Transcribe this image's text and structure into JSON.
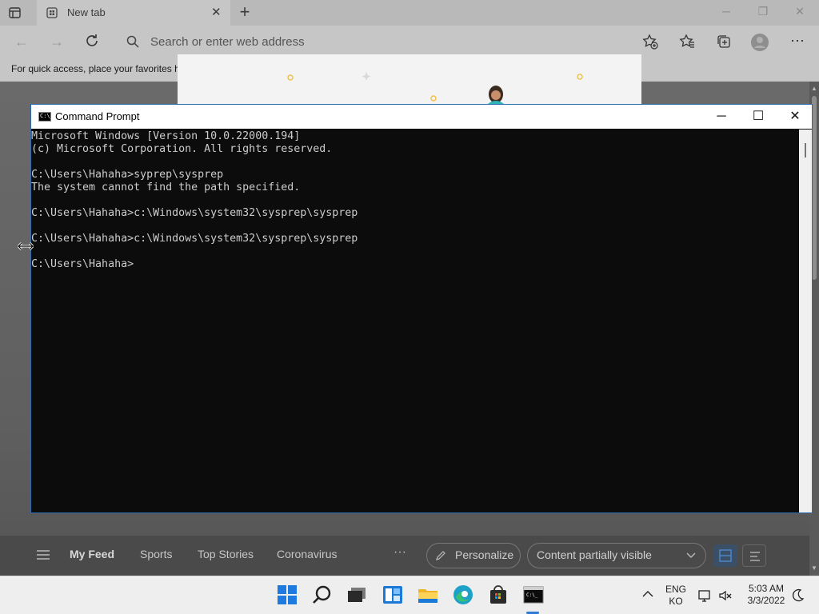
{
  "browser": {
    "tab": {
      "title": "New tab"
    },
    "address_placeholder": "Search or enter web address",
    "favorites_hint": "For quick access, place your favorites h",
    "feed": {
      "items": [
        "My Feed",
        "Sports",
        "Top Stories",
        "Coronavirus"
      ],
      "more": "···",
      "personalize_label": "Personalize",
      "visibility_label": "Content partially visible"
    }
  },
  "cmd": {
    "title": "Command Prompt",
    "icon_text": "C:\\_",
    "lines": [
      "Microsoft Windows [Version 10.0.22000.194]",
      "(c) Microsoft Corporation. All rights reserved.",
      "",
      "C:\\Users\\Hahaha>syprep\\sysprep",
      "The system cannot find the path specified.",
      "",
      "C:\\Users\\Hahaha>c:\\Windows\\system32\\sysprep\\sysprep",
      "",
      "C:\\Users\\Hahaha>c:\\Windows\\system32\\sysprep\\sysprep",
      "",
      "C:\\Users\\Hahaha>"
    ]
  },
  "taskbar": {
    "lang_line1": "ENG",
    "lang_line2": "KO",
    "time": "5:03 AM",
    "date": "3/3/2022"
  },
  "colors": {
    "console_bg": "#0c0c0c",
    "console_text": "#cccccc",
    "accent": "#2f7bd6"
  },
  "icons": [
    "tab-actions-icon",
    "new-tab-icon",
    "back-icon",
    "forward-icon",
    "refresh-icon",
    "search-icon",
    "add-favorite-icon",
    "favorites-icon",
    "collections-icon",
    "profile-icon",
    "more-icon",
    "windows-start-icon",
    "search-taskbar-icon",
    "task-view-icon",
    "widgets-icon",
    "file-explorer-icon",
    "edge-icon",
    "store-icon",
    "cmd-icon",
    "chevron-up-icon",
    "network-icon",
    "volume-muted-icon",
    "notification-icon"
  ]
}
